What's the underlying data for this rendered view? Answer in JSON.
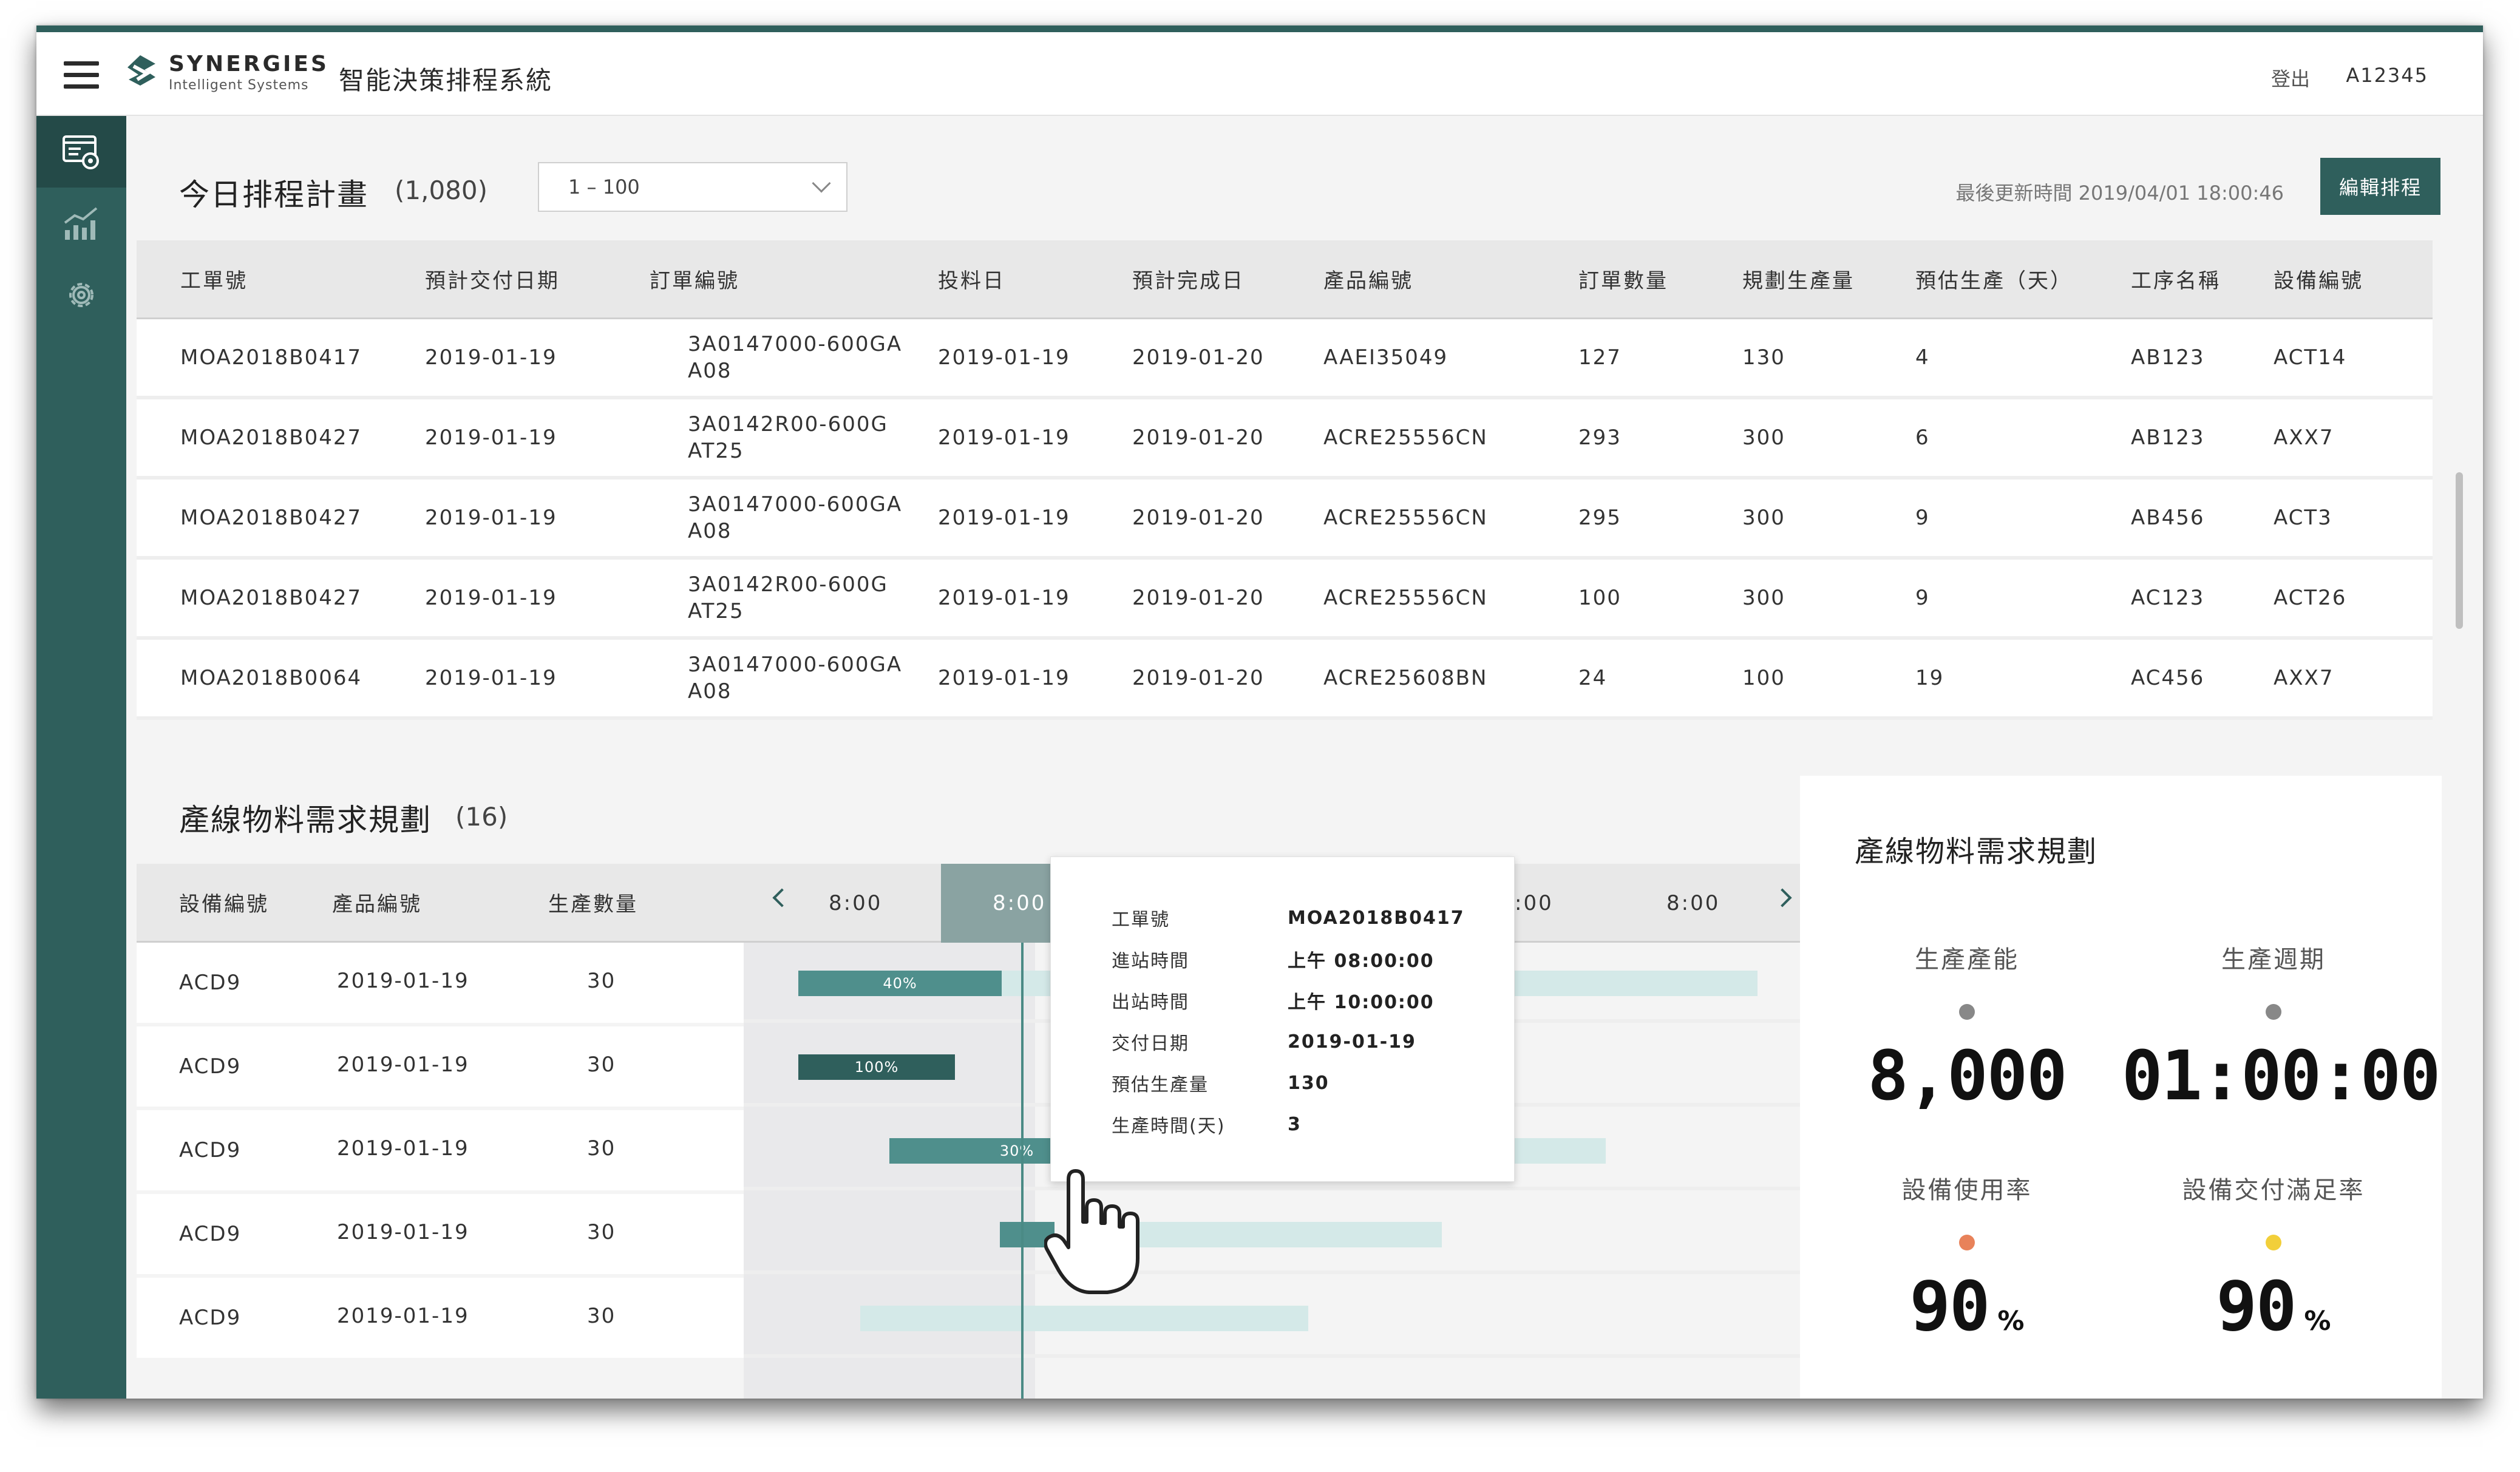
{
  "app": {
    "brand_name": "SYNERGIES",
    "brand_sub": "Intelligent Systems",
    "title": "智能決策排程系統",
    "logout": "登出",
    "user_id": "A12345"
  },
  "colors": {
    "primary": "#2f5f5c",
    "primary_mid": "#4f8f8c",
    "primary_light": "#d4e9e8",
    "orange_dot": "#e8825a",
    "yellow_dot": "#f2cf3a",
    "gray_dot": "#888888"
  },
  "sidebar": {
    "items": [
      {
        "icon": "schedule-view-icon",
        "active": true
      },
      {
        "icon": "analytics-chart-icon",
        "active": false
      },
      {
        "icon": "gear-icon",
        "active": false
      }
    ]
  },
  "schedule": {
    "title": "今日排程計畫",
    "count": "(1,080)",
    "range": "1 – 100",
    "updated": "最後更新時間 2019/04/01 18:00:46",
    "edit_button": "編輯排程",
    "columns": [
      "工單號",
      "預計交付日期",
      "訂單編號",
      "投料日",
      "預計完成日",
      "產品編號",
      "訂單數量",
      "規劃生產量",
      "預估生產（天）",
      "工序名稱",
      "設備編號"
    ],
    "rows": [
      [
        "MOA2018B0417",
        "2019-01-19",
        "3A0147000-600GA",
        "A08",
        "2019-01-19",
        "2019-01-20",
        "AAEI35049",
        "127",
        "130",
        "4",
        "AB123",
        "ACT14"
      ],
      [
        "MOA2018B0427",
        "2019-01-19",
        "3A0142R00-600G",
        "AT25",
        "2019-01-19",
        "2019-01-20",
        "ACRE25556CN",
        "293",
        "300",
        "6",
        "AB123",
        "AXX7"
      ],
      [
        "MOA2018B0427",
        "2019-01-19",
        "3A0147000-600GA",
        "A08",
        "2019-01-19",
        "2019-01-20",
        "ACRE25556CN",
        "295",
        "300",
        "9",
        "AB456",
        "ACT3"
      ],
      [
        "MOA2018B0427",
        "2019-01-19",
        "3A0142R00-600G",
        "AT25",
        "2019-01-19",
        "2019-01-20",
        "ACRE25556CN",
        "100",
        "300",
        "9",
        "AC123",
        "ACT26"
      ],
      [
        "MOA2018B0064",
        "2019-01-19",
        "3A0147000-600GA",
        "A08",
        "2019-01-19",
        "2019-01-20",
        "ACRE25608BN",
        "24",
        "100",
        "19",
        "AC456",
        "AXX7"
      ]
    ]
  },
  "material": {
    "title": "產線物料需求規劃",
    "count": "(16)",
    "columns": [
      "設備編號",
      "產品編號",
      "生產數量"
    ],
    "time_labels": [
      "8:00",
      "8:00",
      "8:00",
      ":00",
      "8:00"
    ],
    "rows": [
      {
        "equipment": "ACD9",
        "date": "2019-01-19",
        "qty": "30",
        "bar_label": "40%",
        "progress": 0.4
      },
      {
        "equipment": "ACD9",
        "date": "2019-01-19",
        "qty": "30",
        "bar_label": "100%",
        "progress": 1.0
      },
      {
        "equipment": "ACD9",
        "date": "2019-01-19",
        "qty": "30",
        "bar_label": "30%",
        "progress": 0.3
      },
      {
        "equipment": "ACD9",
        "date": "2019-01-19",
        "qty": "30",
        "bar_label": "",
        "progress": 0.1
      },
      {
        "equipment": "ACD9",
        "date": "2019-01-19",
        "qty": "30",
        "bar_label": "",
        "progress": 0.0
      }
    ]
  },
  "tooltip": {
    "rows": [
      {
        "key": "工單號",
        "value": "MOA2018B0417"
      },
      {
        "key": "進站時間",
        "value": "上午 08:00:00"
      },
      {
        "key": "出站時間",
        "value": "上午 10:00:00"
      },
      {
        "key": "交付日期",
        "value": "2019-01-19"
      },
      {
        "key": "預估生產量",
        "value": "130"
      },
      {
        "key": "生產時間(天)",
        "value": "3"
      }
    ]
  },
  "metrics": {
    "title": "產線物料需求規劃",
    "capacity_label": "生產產能",
    "capacity_value": "8,000",
    "cycle_label": "生產週期",
    "cycle_value": "01:00:00",
    "utilization_label": "設備使用率",
    "utilization_value": "90",
    "utilization_unit": "%",
    "delivery_label": "設備交付滿足率",
    "delivery_value": "90",
    "delivery_unit": "%"
  }
}
